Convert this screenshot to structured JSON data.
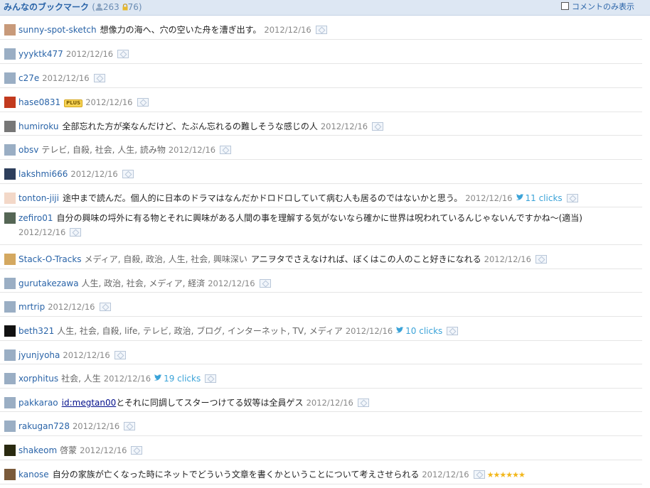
{
  "header": {
    "title": "みんなのブックマーク",
    "paren_open": "(",
    "user_count": "263",
    "private_count": "76",
    "paren_close": ")",
    "toggle_label": "コメントのみ表示"
  },
  "colors": {
    "accent": "#2a64a8",
    "header_bg": "#dde7f3",
    "twitter": "#3ba3d8",
    "star": "#f2b71b"
  },
  "rows": [
    {
      "user": "sunny-spot-sketch",
      "avatar_color": "#c89a7a",
      "tags": "",
      "comment": "想像力の海へ、穴の空いた舟を漕ぎ出す。",
      "date": "2012/12/16"
    },
    {
      "user": "yyyktk477",
      "avatar_color": "#9aaec4",
      "tags": "",
      "comment": "",
      "date": "2012/12/16"
    },
    {
      "user": "c27e",
      "avatar_color": "#9aaec4",
      "tags": "",
      "comment": "",
      "date": "2012/12/16"
    },
    {
      "user": "hase0831",
      "avatar_color": "#c23a1e",
      "badge": "PLUS",
      "tags": "",
      "comment": "",
      "date": "2012/12/16"
    },
    {
      "user": "humiroku",
      "avatar_color": "#777777",
      "tags": "",
      "comment": "全部忘れた方が楽なんだけど、たぶん忘れるの難しそうな感じの人",
      "date": "2012/12/16"
    },
    {
      "user": "obsv",
      "avatar_color": "#9aaec4",
      "tags": "テレビ, 自殺, 社会, 人生, 読み物",
      "comment": "",
      "date": "2012/12/16"
    },
    {
      "user": "lakshmi666",
      "avatar_color": "#2d3e5c",
      "tags": "",
      "comment": "",
      "date": "2012/12/16"
    },
    {
      "user": "tonton-jiji",
      "avatar_color": "#f3d8c8",
      "tags": "",
      "comment": "途中まで読んだ。個人的に日本のドラマはなんだかドロドロしていて病む人も居るのではないかと思う。",
      "date": "2012/12/16",
      "clicks": "11 clicks"
    },
    {
      "user": "zefiro01",
      "avatar_color": "#556655",
      "tags": "",
      "comment": "自分の興味の埒外に有る物とそれに興味がある人間の事を理解する気がないなら確かに世界は呪われているんじゃないんですかね～(適当)",
      "date": "2012/12/16"
    },
    {
      "user": "Stack-O-Tracks",
      "avatar_color": "#d4a860",
      "tags": "メディア, 自殺, 政治, 人生, 社会, 興味深い",
      "comment": "アニヲタでさえなければ、ぼくはこの人のこと好きになれる",
      "date": "2012/12/16"
    },
    {
      "user": "gurutakezawa",
      "avatar_color": "#9aaec4",
      "tags": "人生, 政治, 社会, メディア, 経済",
      "comment": "",
      "date": "2012/12/16"
    },
    {
      "user": "mrtrip",
      "avatar_color": "#9aaec4",
      "tags": "",
      "comment": "",
      "date": "2012/12/16"
    },
    {
      "user": "beth321",
      "avatar_color": "#111111",
      "tags": "人生, 社会, 自殺, life, テレビ, 政治, ブログ, インターネット, TV, メディア",
      "comment": "",
      "date": "2012/12/16",
      "clicks": "10 clicks"
    },
    {
      "user": "jyunjyoha",
      "avatar_color": "#9aaec4",
      "tags": "",
      "comment": "",
      "date": "2012/12/16"
    },
    {
      "user": "xorphitus",
      "avatar_color": "#9aaec4",
      "tags": "社会, 人生",
      "comment": "",
      "date": "2012/12/16",
      "clicks": "19 clicks"
    },
    {
      "user": "pakkarao",
      "avatar_color": "#9aaec4",
      "tags": "",
      "mention": "id:megtan00",
      "comment": "とそれに同調してスターつけてる奴等は全員ゲス",
      "date": "2012/12/16"
    },
    {
      "user": "rakugan728",
      "avatar_color": "#9aaec4",
      "tags": "",
      "comment": "",
      "date": "2012/12/16"
    },
    {
      "user": "shakeom",
      "avatar_color": "#2a2a10",
      "tags": "啓蒙",
      "comment": "",
      "date": "2012/12/16"
    },
    {
      "user": "kanose",
      "avatar_color": "#7a5a3a",
      "tags": "",
      "comment": "自分の家族が亡くなった時にネットでどういう文章を書くかということについて考えさせられる",
      "date": "2012/12/16",
      "stars": "★★★★★★"
    }
  ]
}
